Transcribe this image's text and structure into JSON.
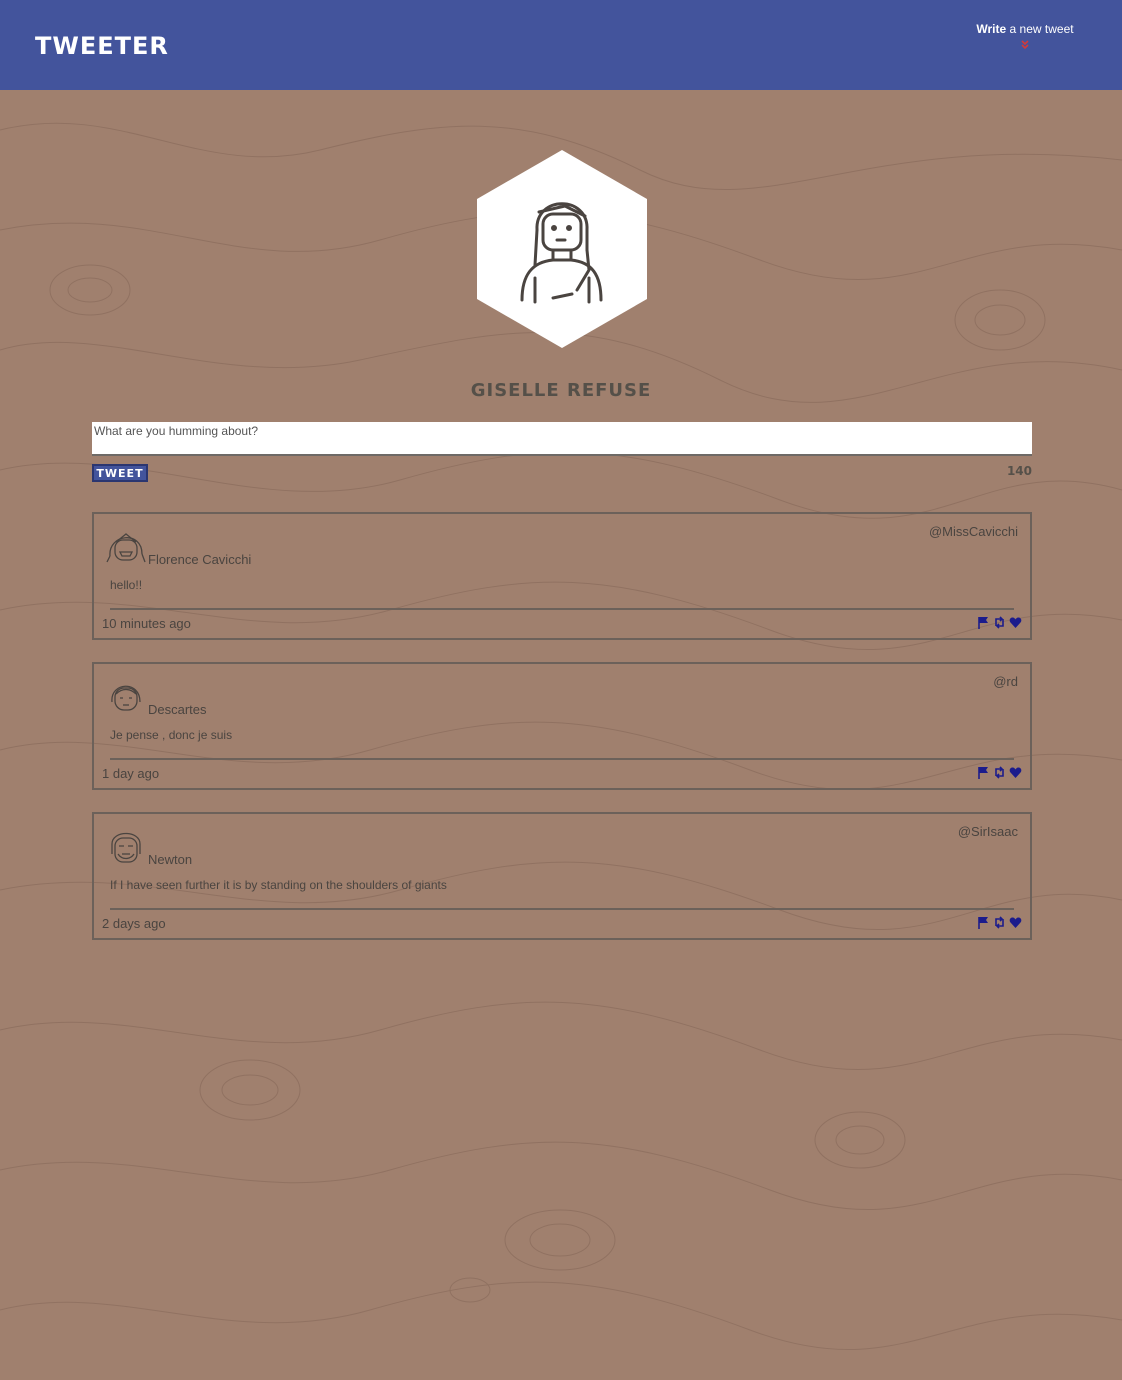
{
  "nav": {
    "brand": "TWEETER",
    "compose_bold": "Write",
    "compose_rest": " a new tweet"
  },
  "profile": {
    "name": "GISELLE REFUSE"
  },
  "composer": {
    "placeholder": "What are you humming about?",
    "button": "TWEET",
    "counter": "140"
  },
  "tweets": [
    {
      "name": "Florence Cavicchi",
      "handle": "@MissCavicchi",
      "body": "hello!!",
      "time": "10 minutes ago"
    },
    {
      "name": "Descartes",
      "handle": "@rd",
      "body": "Je pense , donc je suis",
      "time": "1 day ago"
    },
    {
      "name": "Newton",
      "handle": "@SirIsaac",
      "body": "If I have seen further it is by standing on the shoulders of giants",
      "time": "2 days ago"
    }
  ],
  "colors": {
    "nav": "#43549c",
    "background": "#a0806e",
    "accent_icons": "#1c1c8c",
    "chevron": "#d23a3a"
  }
}
